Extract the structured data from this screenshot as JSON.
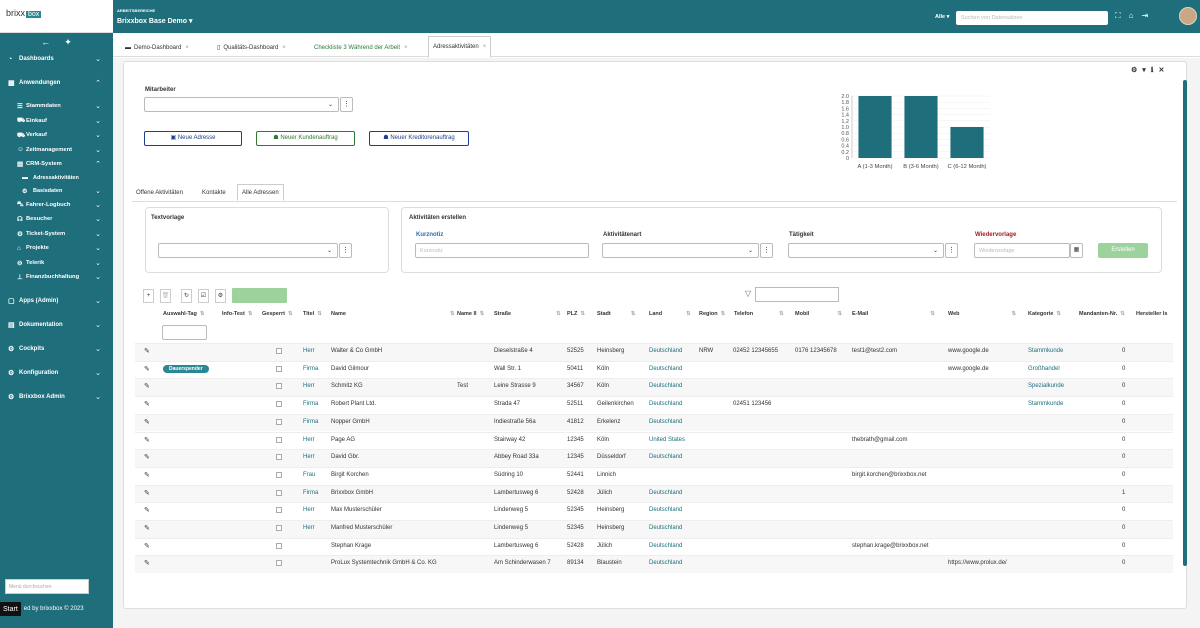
{
  "sidebar": {
    "logo": "brixx",
    "logo_tag": "box",
    "items": {
      "dashboards": "Dashboards",
      "anwendungen": "Anwendungen",
      "stammdaten": "Stammdaten",
      "einkauf": "Einkauf",
      "verkauf": "Verkauf",
      "zeitmanagement": "Zeitmanagement",
      "crm": "CRM-System",
      "adressaktivitaeten": "Adressaktivitäten",
      "basisdaten": "Basisdaten",
      "fahrer": "Fahrer-Logbuch",
      "besucher": "Besucher",
      "ticket": "Ticket-System",
      "projekte": "Projekte",
      "telerik": "Telerik",
      "finanz": "Finanzbuchhaltung",
      "apps": "Apps (Admin)",
      "doku": "Dokumentation",
      "cockpits": "Cockpits",
      "konfig": "Konfiguration",
      "brixxadmin": "Brixxbox Admin"
    },
    "search_placeholder": "Menü durchsuchen",
    "footer": "ed by brixxbox © 2023",
    "start": "Start"
  },
  "header": {
    "workspace_label": "ARBEITSBEREICHE",
    "workspace": "Brixxbox Base Demo",
    "filter": "Alle",
    "search_placeholder": "Suchen von Datensätzen"
  },
  "tabs": [
    "Demo-Dashboard",
    "Qualitäts-Dashboard",
    "Checkliste 3 Während der Arbeit",
    "Adressaktivitäten"
  ],
  "form": {
    "mitarbeiter_label": "Mitarbeiter",
    "btn_neue_adresse": "Neue Adresse",
    "btn_kundenauftrag": "Neuer Kundenauftrag",
    "btn_kreditorenauftrag": "Neuer Kreditorenauftrag"
  },
  "inner_tabs": [
    "Offene Aktivitäten",
    "Kontakte",
    "Alle Adressen"
  ],
  "textvorlage": {
    "label": "Textvorlage"
  },
  "aktivitaeten": {
    "title": "Aktivitäten erstellen",
    "kurznotiz": "Kurznotiz",
    "kurznotiz_placeholder": "Kurznotiz",
    "art": "Aktivitätenart",
    "taetigkeit": "Tätigkeit",
    "wiedervorlage": "Wiedervorlage",
    "wiedervorlage_placeholder": "Wiedervorlage",
    "erstellen": "Erstellen"
  },
  "table": {
    "headers": [
      "Auswahl-Tag",
      "Info-Test",
      "Gesperrt",
      "Titel",
      "Name",
      "Name II",
      "Straße",
      "PLZ",
      "Stadt",
      "Land",
      "Region",
      "Telefon",
      "Mobil",
      "E-Mail",
      "Web",
      "Kategorie",
      "Mandanten-Nr.",
      "Hersteller Is"
    ],
    "rows": [
      {
        "tag": "",
        "titel": "Herr",
        "name": "Walter & Co GmbH",
        "name2": "",
        "strasse": "Dieselstraße 4",
        "plz": "52525",
        "stadt": "Heinsberg",
        "land": "Deutschland",
        "region": "NRW",
        "telefon": "02452 12345655",
        "mobil": "0176 12345678",
        "email": "test1@test2.com",
        "web": "www.google.de",
        "kategorie": "Stammkunde",
        "mandant": "0"
      },
      {
        "tag": "Dauerspender",
        "titel": "Firma",
        "name": "David Gilmour",
        "name2": "",
        "strasse": "Wall Str. 1",
        "plz": "50411",
        "stadt": "Köln",
        "land": "Deutschland",
        "region": "",
        "telefon": "",
        "mobil": "",
        "email": "",
        "web": "www.google.de",
        "kategorie": "Großhandel",
        "mandant": "0"
      },
      {
        "tag": "",
        "titel": "Herr",
        "name": "Schmitz KG",
        "name2": "Test",
        "strasse": "Leine Strasse 9",
        "plz": "34567",
        "stadt": "Köln",
        "land": "Deutschland",
        "region": "",
        "telefon": "",
        "mobil": "",
        "email": "",
        "web": "",
        "kategorie": "Spezialkunde",
        "mandant": "0"
      },
      {
        "tag": "",
        "titel": "Firma",
        "name": "Robert Plant Ltd.",
        "name2": "",
        "strasse": "Strada 47",
        "plz": "52511",
        "stadt": "Geilenkirchen",
        "land": "Deutschland",
        "region": "",
        "telefon": "02451 123456",
        "mobil": "",
        "email": "",
        "web": "",
        "kategorie": "Stammkunde",
        "mandant": "0"
      },
      {
        "tag": "",
        "titel": "Firma",
        "name": "Nopper GmbH",
        "name2": "",
        "strasse": "Indiestraße 56a",
        "plz": "41812",
        "stadt": "Erkelenz",
        "land": "Deutschland",
        "region": "",
        "telefon": "",
        "mobil": "",
        "email": "",
        "web": "",
        "kategorie": "",
        "mandant": "0"
      },
      {
        "tag": "",
        "titel": "Herr",
        "name": "Page AG",
        "name2": "",
        "strasse": "Stairway 42",
        "plz": "12345",
        "stadt": "Köln",
        "land": "United States",
        "region": "",
        "telefon": "",
        "mobil": "",
        "email": "thebrath@gmail.com",
        "web": "",
        "kategorie": "",
        "mandant": "0"
      },
      {
        "tag": "",
        "titel": "Herr",
        "name": "David Gbr.",
        "name2": "",
        "strasse": "Abbey Road 33a",
        "plz": "12345",
        "stadt": "Düsseldorf",
        "land": "Deutschland",
        "region": "",
        "telefon": "",
        "mobil": "",
        "email": "",
        "web": "",
        "kategorie": "",
        "mandant": "0"
      },
      {
        "tag": "",
        "titel": "Frau",
        "name": "Birgit Korchen",
        "name2": "",
        "strasse": "Südring 10",
        "plz": "52441",
        "stadt": "Linnich",
        "land": "",
        "region": "",
        "telefon": "",
        "mobil": "",
        "email": "birgit.korchen@brixxbox.net",
        "web": "",
        "kategorie": "",
        "mandant": "0"
      },
      {
        "tag": "",
        "titel": "Firma",
        "name": "Brixxbox GmbH",
        "name2": "",
        "strasse": "Lambertusweg 6",
        "plz": "52428",
        "stadt": "Jülich",
        "land": "Deutschland",
        "region": "",
        "telefon": "",
        "mobil": "",
        "email": "",
        "web": "",
        "kategorie": "",
        "mandant": "1"
      },
      {
        "tag": "",
        "titel": "Herr",
        "name": "Max Musterschüler",
        "name2": "",
        "strasse": "Lindenweg 5",
        "plz": "52345",
        "stadt": "Heinsberg",
        "land": "Deutschland",
        "region": "",
        "telefon": "",
        "mobil": "",
        "email": "",
        "web": "",
        "kategorie": "",
        "mandant": "0"
      },
      {
        "tag": "",
        "titel": "Herr",
        "name": "Manfred Musterschüler",
        "name2": "",
        "strasse": "Lindenweg 5",
        "plz": "52345",
        "stadt": "Heinsberg",
        "land": "Deutschland",
        "region": "",
        "telefon": "",
        "mobil": "",
        "email": "",
        "web": "",
        "kategorie": "",
        "mandant": "0"
      },
      {
        "tag": "",
        "titel": "",
        "name": "Stephan Krage",
        "name2": "",
        "strasse": "Lambertusweg 6",
        "plz": "52428",
        "stadt": "Jülich",
        "land": "Deutschland",
        "region": "",
        "telefon": "",
        "mobil": "",
        "email": "stephan.krage@brixxbox.net",
        "web": "",
        "kategorie": "",
        "mandant": "0"
      },
      {
        "tag": "",
        "titel": "",
        "name": "ProLux Systemtechnik GmbH & Co. KG",
        "name2": "",
        "strasse": "Am Schinderwasen 7",
        "plz": "89134",
        "stadt": "Blaustein",
        "land": "Deutschland",
        "region": "",
        "telefon": "",
        "mobil": "",
        "email": "",
        "web": "https://www.prolux.de/",
        "kategorie": "",
        "mandant": "0"
      }
    ]
  },
  "chart_data": {
    "type": "bar",
    "categories": [
      "A (1-3 Month)",
      "B (3-6 Month)",
      "C (6-12 Month)"
    ],
    "values": [
      2,
      2,
      1
    ],
    "ylim": [
      0,
      2.0
    ],
    "yticks": [
      "2.0",
      "1.8",
      "1.6",
      "1.4",
      "1.2",
      "1.0",
      "0.8",
      "0.6",
      "0.4",
      "0.2",
      "0"
    ],
    "color": "#1e6e7b"
  }
}
